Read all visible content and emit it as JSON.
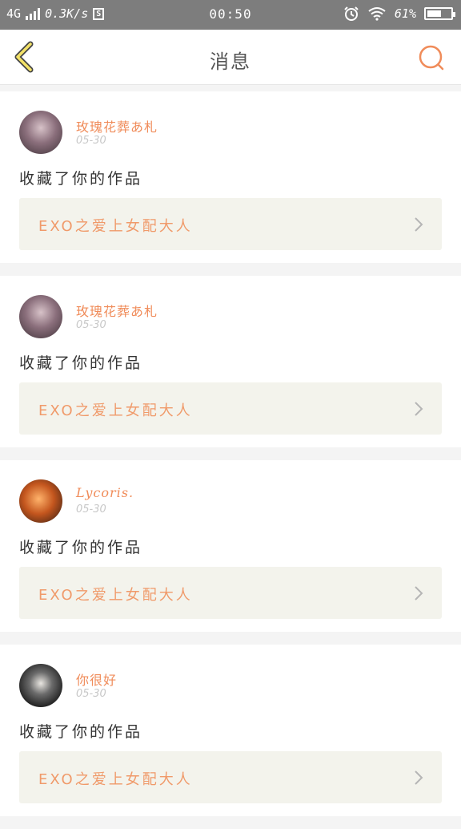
{
  "status_bar": {
    "network": "4G",
    "speed": "0.3K/s",
    "s_badge": "S",
    "time": "00:50",
    "battery_text": "61%",
    "battery_level": 0.61
  },
  "nav": {
    "title": "消息",
    "back_icon": "back-chevron-icon",
    "search_icon": "search-icon",
    "accent": "#f08c5a"
  },
  "feed": [
    {
      "username": "玫瑰花葬あ札",
      "date": "05-30",
      "action": "收藏了你的作品",
      "work": "EXO之爱上女配大人"
    },
    {
      "username": "玫瑰花葬あ札",
      "date": "05-30",
      "action": "收藏了你的作品",
      "work": "EXO之爱上女配大人"
    },
    {
      "username": "Lycoris.",
      "date": "05-30",
      "action": "收藏了你的作品",
      "work": "EXO之爱上女配大人"
    },
    {
      "username": "你很好",
      "date": "05-30",
      "action": "收藏了你的作品",
      "work": "EXO之爱上女配大人"
    }
  ]
}
